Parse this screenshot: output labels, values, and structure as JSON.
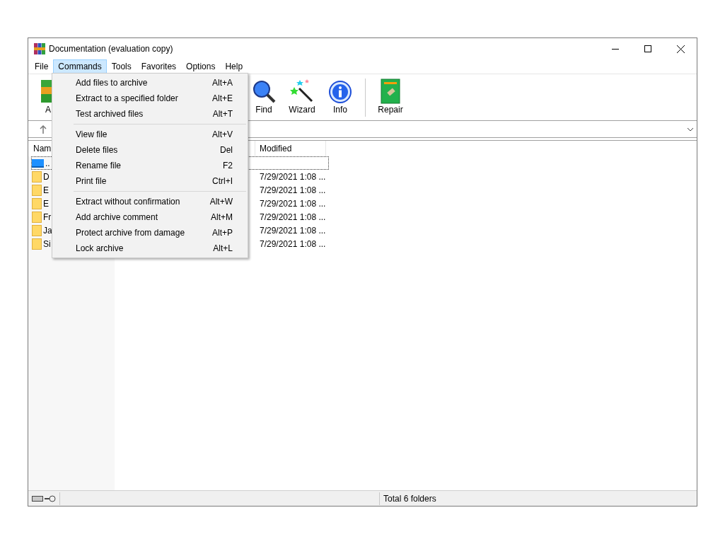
{
  "window": {
    "title": "Documentation (evaluation copy)"
  },
  "menu_bar": [
    {
      "label": "File",
      "selected": false
    },
    {
      "label": "Commands",
      "selected": true
    },
    {
      "label": "Tools",
      "selected": false
    },
    {
      "label": "Favorites",
      "selected": false
    },
    {
      "label": "Options",
      "selected": false
    },
    {
      "label": "Help",
      "selected": false
    }
  ],
  "toolbar": [
    {
      "kind": "add",
      "label": "A"
    },
    {
      "kind": "find",
      "label": "Find"
    },
    {
      "kind": "wizard",
      "label": "Wizard"
    },
    {
      "kind": "info",
      "label": "Info"
    },
    {
      "kind": "separator"
    },
    {
      "kind": "repair",
      "label": "Repair"
    }
  ],
  "file_list": {
    "columns": [
      "Nam",
      "Modified"
    ],
    "rows": [
      {
        "kind": "up",
        "name": "..",
        "modified": "",
        "focused": true
      },
      {
        "kind": "folder",
        "name": "D",
        "modified": "7/29/2021 1:08 ...",
        "focused": false
      },
      {
        "kind": "folder",
        "name": "E",
        "modified": "7/29/2021 1:08 ...",
        "focused": false
      },
      {
        "kind": "folder",
        "name": "E",
        "modified": "7/29/2021 1:08 ...",
        "focused": false
      },
      {
        "kind": "folder",
        "name": "Fr",
        "modified": "7/29/2021 1:08 ...",
        "focused": false
      },
      {
        "kind": "folder",
        "name": "Ja",
        "modified": "7/29/2021 1:08 ...",
        "focused": false
      },
      {
        "kind": "folder",
        "name": "Si",
        "modified": "7/29/2021 1:08 ...",
        "focused": false
      }
    ]
  },
  "commands_menu": [
    [
      {
        "label": "Add files to archive",
        "shortcut": "Alt+A"
      },
      {
        "label": "Extract to a specified folder",
        "shortcut": "Alt+E"
      },
      {
        "label": "Test archived files",
        "shortcut": "Alt+T"
      }
    ],
    [
      {
        "label": "View file",
        "shortcut": "Alt+V"
      },
      {
        "label": "Delete files",
        "shortcut": "Del"
      },
      {
        "label": "Rename file",
        "shortcut": "F2"
      },
      {
        "label": "Print file",
        "shortcut": "Ctrl+I"
      }
    ],
    [
      {
        "label": "Extract without confirmation",
        "shortcut": "Alt+W"
      },
      {
        "label": "Add archive comment",
        "shortcut": "Alt+M"
      },
      {
        "label": "Protect archive from damage",
        "shortcut": "Alt+P"
      },
      {
        "label": "Lock archive",
        "shortcut": "Alt+L"
      }
    ]
  ],
  "status_bar": {
    "text": "Total 6 folders"
  }
}
